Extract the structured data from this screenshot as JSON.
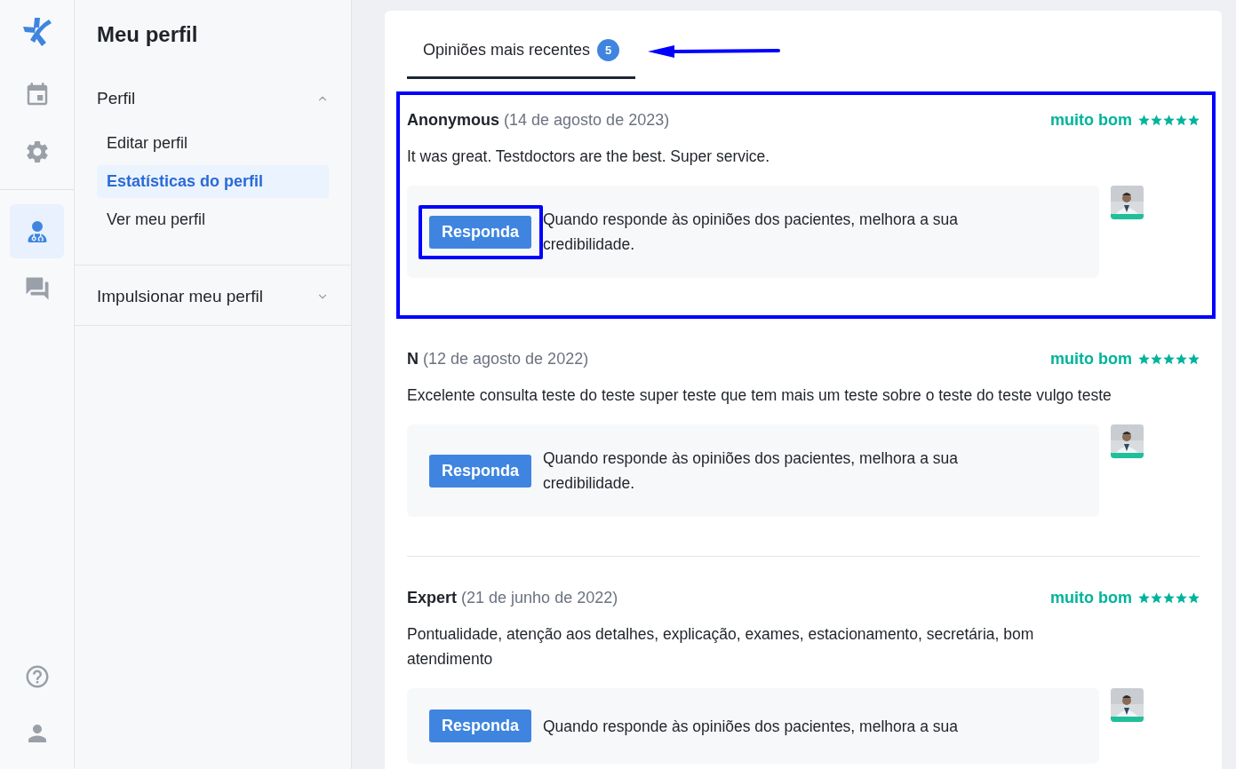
{
  "rail": {
    "top": [
      {
        "kind": "calendar",
        "selected": false
      },
      {
        "kind": "settings",
        "selected": false
      }
    ],
    "middle": [
      {
        "kind": "doctor",
        "selected": true
      },
      {
        "kind": "chat",
        "selected": false
      }
    ],
    "bottom": [
      {
        "kind": "help",
        "selected": false
      },
      {
        "kind": "user",
        "selected": false
      }
    ]
  },
  "sidebar": {
    "title": "Meu perfil",
    "sections": [
      {
        "label": "Perfil",
        "expanded": true,
        "items": [
          {
            "label": "Editar perfil",
            "selected": false
          },
          {
            "label": "Estatísticas do perfil",
            "selected": true
          },
          {
            "label": "Ver meu perfil",
            "selected": false
          }
        ]
      },
      {
        "label": "Impulsionar meu perfil",
        "expanded": false
      }
    ]
  },
  "tabs": [
    {
      "label": "Opiniões mais recentes",
      "count": "5",
      "selected": true,
      "pointer_arrow": true
    }
  ],
  "reviews": [
    {
      "author": "Anonymous",
      "date": "(14 de agosto de 2023)",
      "rating": "muito bom",
      "stars": 5,
      "comment": "It was great. Testdoctors are the best. Super service.",
      "reply_button": "Responda",
      "hint": "Quando responde às opiniões dos pacientes, melhora a sua credibilidade.",
      "highlighted": true,
      "reply_highlighted": true
    },
    {
      "author": "N",
      "date": "(12 de agosto de 2022)",
      "rating": "muito bom",
      "stars": 5,
      "comment": "Excelente consulta teste do teste super teste que tem mais um teste sobre o teste do teste vulgo teste",
      "reply_button": "Responda",
      "hint": "Quando responde às opiniões dos pacientes, melhora a sua credibilidade.",
      "highlighted": false,
      "reply_highlighted": false
    },
    {
      "author": "Expert",
      "date": "(21 de junho de 2022)",
      "rating": "muito bom",
      "stars": 5,
      "comment": "Pontualidade, atenção aos detalhes, explicação, exames, estacionamento, secretária, bom atendimento",
      "reply_button": "Responda",
      "hint": "Quando responde às opiniões dos pacientes, melhora a sua",
      "highlighted": false,
      "reply_highlighted": false
    }
  ]
}
